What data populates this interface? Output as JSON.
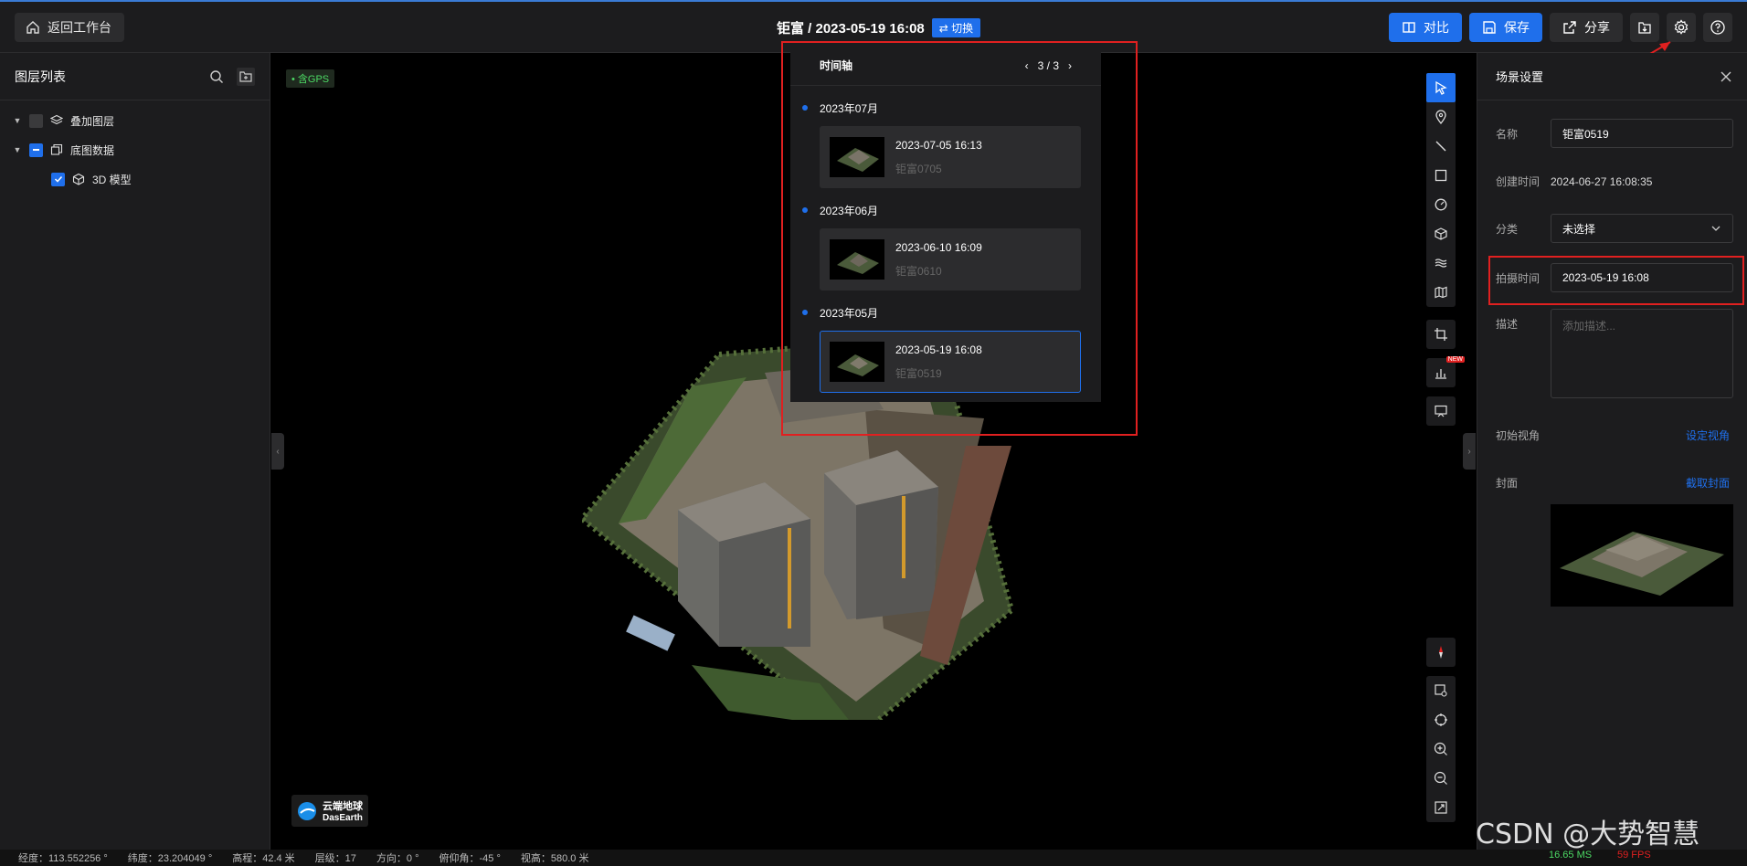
{
  "topbar": {
    "back_label": "返回工作台",
    "title": "钜富 / 2023-05-19 16:08",
    "switch_label": "⇄ 切换",
    "compare_label": "对比",
    "save_label": "保存",
    "share_label": "分享"
  },
  "layers": {
    "title": "图层列表",
    "items": [
      {
        "label": "叠加图层"
      },
      {
        "label": "底图数据"
      },
      {
        "label": "3D 模型"
      }
    ]
  },
  "viewport": {
    "gps_badge": "• 含GPS",
    "logo_cn": "云端地球",
    "logo_en": "DasEarth"
  },
  "timeline": {
    "title": "时间轴",
    "pager": "3 / 3",
    "groups": [
      {
        "month": "2023年07月",
        "date": "2023-07-05 16:13",
        "name": "钜富0705"
      },
      {
        "month": "2023年06月",
        "date": "2023-06-10 16:09",
        "name": "钜富0610"
      },
      {
        "month": "2023年05月",
        "date": "2023-05-19 16:08",
        "name": "钜富0519"
      }
    ]
  },
  "settings": {
    "title": "场景设置",
    "name_label": "名称",
    "name_value": "钜富0519",
    "created_label": "创建时间",
    "created_value": "2024-06-27 16:08:35",
    "category_label": "分类",
    "category_value": "未选择",
    "shot_time_label": "拍摄时间",
    "shot_time_value": "2023-05-19 16:08",
    "desc_label": "描述",
    "desc_placeholder": "添加描述...",
    "view_label": "初始视角",
    "view_link": "设定视角",
    "cover_label": "封面",
    "cover_link": "截取封面"
  },
  "status": {
    "lon": "经度：113.552256 °",
    "lat": "纬度：23.204049 °",
    "alt": "高程：42.4 米",
    "level": "层级：17",
    "heading": "方向：0 °",
    "pitch": "俯仰角：-45 °",
    "view_height": "视高：580.0 米",
    "ms": "16.65 MS",
    "fps": "59 FPS"
  },
  "watermark": "CSDN @大势智慧",
  "colors": {
    "accent": "#1f6feb",
    "highlight": "#e02020",
    "panel": "#1c1c1e"
  }
}
